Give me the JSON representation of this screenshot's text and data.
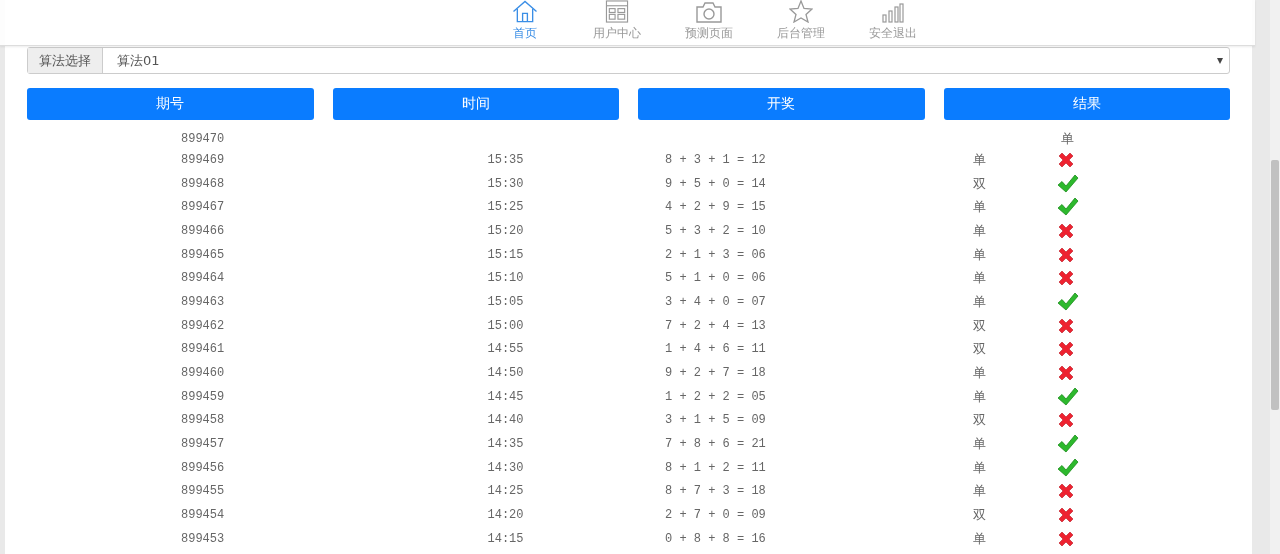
{
  "nav": {
    "items": [
      {
        "label": "首页",
        "selected": true
      },
      {
        "label": "用户中心",
        "selected": false
      },
      {
        "label": "预测页面",
        "selected": false
      },
      {
        "label": "后台管理",
        "selected": false
      },
      {
        "label": "安全退出",
        "selected": false
      }
    ]
  },
  "form": [
    {
      "label": "算法选择",
      "value": "算法01"
    }
  ],
  "table": {
    "columns": [
      "期号",
      "时间",
      "开奖",
      "结果"
    ],
    "rows": [
      {
        "kind": "pending",
        "issue": "899470",
        "pick": "单"
      },
      {
        "kind": "drawn",
        "issue": "899469",
        "time": "15:35",
        "draw": "8 + 3 + 1 = 12",
        "pick": "单",
        "correct": false
      },
      {
        "kind": "drawn",
        "issue": "899468",
        "time": "15:30",
        "draw": "9 + 5 + 0 = 14",
        "pick": "双",
        "correct": true
      },
      {
        "kind": "drawn",
        "issue": "899467",
        "time": "15:25",
        "draw": "4 + 2 + 9 = 15",
        "pick": "单",
        "correct": true
      },
      {
        "kind": "drawn",
        "issue": "899466",
        "time": "15:20",
        "draw": "5 + 3 + 2 = 10",
        "pick": "单",
        "correct": false
      },
      {
        "kind": "drawn",
        "issue": "899465",
        "time": "15:15",
        "draw": "2 + 1 + 3 = 06",
        "pick": "单",
        "correct": false
      },
      {
        "kind": "drawn",
        "issue": "899464",
        "time": "15:10",
        "draw": "5 + 1 + 0 = 06",
        "pick": "单",
        "correct": false
      },
      {
        "kind": "drawn",
        "issue": "899463",
        "time": "15:05",
        "draw": "3 + 4 + 0 = 07",
        "pick": "单",
        "correct": true
      },
      {
        "kind": "drawn",
        "issue": "899462",
        "time": "15:00",
        "draw": "7 + 2 + 4 = 13",
        "pick": "双",
        "correct": false
      },
      {
        "kind": "drawn",
        "issue": "899461",
        "time": "14:55",
        "draw": "1 + 4 + 6 = 11",
        "pick": "双",
        "correct": false
      },
      {
        "kind": "drawn",
        "issue": "899460",
        "time": "14:50",
        "draw": "9 + 2 + 7 = 18",
        "pick": "单",
        "correct": false
      },
      {
        "kind": "drawn",
        "issue": "899459",
        "time": "14:45",
        "draw": "1 + 2 + 2 = 05",
        "pick": "单",
        "correct": true
      },
      {
        "kind": "drawn",
        "issue": "899458",
        "time": "14:40",
        "draw": "3 + 1 + 5 = 09",
        "pick": "双",
        "correct": false
      },
      {
        "kind": "drawn",
        "issue": "899457",
        "time": "14:35",
        "draw": "7 + 8 + 6 = 21",
        "pick": "单",
        "correct": true
      },
      {
        "kind": "drawn",
        "issue": "899456",
        "time": "14:30",
        "draw": "8 + 1 + 2 = 11",
        "pick": "单",
        "correct": true
      },
      {
        "kind": "drawn",
        "issue": "899455",
        "time": "14:25",
        "draw": "8 + 7 + 3 = 18",
        "pick": "单",
        "correct": false
      },
      {
        "kind": "drawn",
        "issue": "899454",
        "time": "14:20",
        "draw": "2 + 7 + 0 = 09",
        "pick": "双",
        "correct": false
      },
      {
        "kind": "drawn",
        "issue": "899453",
        "time": "14:15",
        "draw": "0 + 8 + 8 = 16",
        "pick": "单",
        "correct": false
      }
    ]
  }
}
